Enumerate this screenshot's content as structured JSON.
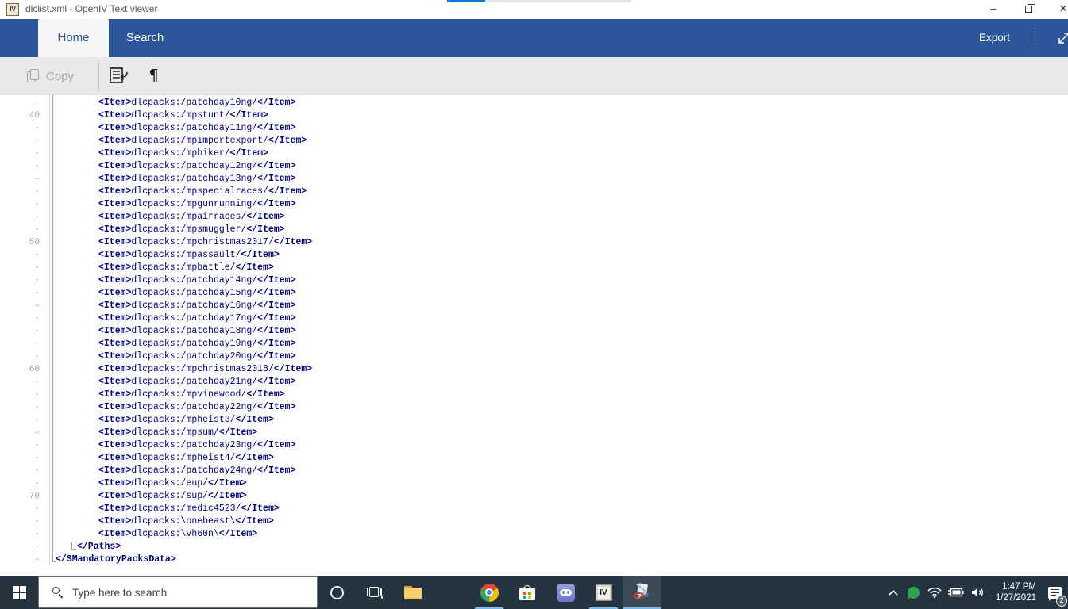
{
  "window": {
    "title": "dlclist.xml - OpenIV Text viewer",
    "icon_label": "IV"
  },
  "ribbon": {
    "tabs": [
      {
        "id": "home",
        "label": "Home",
        "active": true
      },
      {
        "id": "search",
        "label": "Search",
        "active": false
      }
    ],
    "export_label": "Export"
  },
  "toolbar": {
    "copy_label": "Copy",
    "icons": [
      "word-wrap-icon",
      "pilcrow-icon"
    ]
  },
  "editor": {
    "lines": [
      {
        "marker": "-",
        "indent": 2,
        "tag": "Item",
        "text": "dlcpacks:/patchday10ng/"
      },
      {
        "marker": "40",
        "indent": 2,
        "tag": "Item",
        "text": "dlcpacks:/mpstunt/"
      },
      {
        "marker": "-",
        "indent": 2,
        "tag": "Item",
        "text": "dlcpacks:/patchday11ng/"
      },
      {
        "marker": "-",
        "indent": 2,
        "tag": "Item",
        "text": "dlcpacks:/mpimportexport/"
      },
      {
        "marker": "-",
        "indent": 2,
        "tag": "Item",
        "text": "dlcpacks:/mpbiker/"
      },
      {
        "marker": "-",
        "indent": 2,
        "tag": "Item",
        "text": "dlcpacks:/patchday12ng/"
      },
      {
        "marker": "–",
        "indent": 2,
        "tag": "Item",
        "text": "dlcpacks:/patchday13ng/"
      },
      {
        "marker": "-",
        "indent": 2,
        "tag": "Item",
        "text": "dlcpacks:/mpspecialraces/"
      },
      {
        "marker": "-",
        "indent": 2,
        "tag": "Item",
        "text": "dlcpacks:/mpgunrunning/"
      },
      {
        "marker": "-",
        "indent": 2,
        "tag": "Item",
        "text": "dlcpacks:/mpairraces/"
      },
      {
        "marker": "-",
        "indent": 2,
        "tag": "Item",
        "text": "dlcpacks:/mpsmuggler/"
      },
      {
        "marker": "50",
        "indent": 2,
        "tag": "Item",
        "text": "dlcpacks:/mpchristmas2017/"
      },
      {
        "marker": "-",
        "indent": 2,
        "tag": "Item",
        "text": "dlcpacks:/mpassault/"
      },
      {
        "marker": "-",
        "indent": 2,
        "tag": "Item",
        "text": "dlcpacks:/mpbattle/"
      },
      {
        "marker": "-",
        "indent": 2,
        "tag": "Item",
        "text": "dlcpacks:/patchday14ng/"
      },
      {
        "marker": "-",
        "indent": 2,
        "tag": "Item",
        "text": "dlcpacks:/patchday15ng/"
      },
      {
        "marker": "–",
        "indent": 2,
        "tag": "Item",
        "text": "dlcpacks:/patchday16ng/"
      },
      {
        "marker": "-",
        "indent": 2,
        "tag": "Item",
        "text": "dlcpacks:/patchday17ng/"
      },
      {
        "marker": "-",
        "indent": 2,
        "tag": "Item",
        "text": "dlcpacks:/patchday18ng/"
      },
      {
        "marker": "-",
        "indent": 2,
        "tag": "Item",
        "text": "dlcpacks:/patchday19ng/"
      },
      {
        "marker": "-",
        "indent": 2,
        "tag": "Item",
        "text": "dlcpacks:/patchday20ng/"
      },
      {
        "marker": "60",
        "indent": 2,
        "tag": "Item",
        "text": "dlcpacks:/mpchristmas2018/"
      },
      {
        "marker": "-",
        "indent": 2,
        "tag": "Item",
        "text": "dlcpacks:/patchday21ng/"
      },
      {
        "marker": "-",
        "indent": 2,
        "tag": "Item",
        "text": "dlcpacks:/mpvinewood/"
      },
      {
        "marker": "-",
        "indent": 2,
        "tag": "Item",
        "text": "dlcpacks:/patchday22ng/"
      },
      {
        "marker": "-",
        "indent": 2,
        "tag": "Item",
        "text": "dlcpacks:/mpheist3/"
      },
      {
        "marker": "–",
        "indent": 2,
        "tag": "Item",
        "text": "dlcpacks:/mpsum/"
      },
      {
        "marker": "-",
        "indent": 2,
        "tag": "Item",
        "text": "dlcpacks:/patchday23ng/"
      },
      {
        "marker": "-",
        "indent": 2,
        "tag": "Item",
        "text": "dlcpacks:/mpheist4/"
      },
      {
        "marker": "-",
        "indent": 2,
        "tag": "Item",
        "text": "dlcpacks:/patchday24ng/"
      },
      {
        "marker": "-",
        "indent": 2,
        "tag": "Item",
        "text": "dlcpacks:/eup/"
      },
      {
        "marker": "70",
        "indent": 2,
        "tag": "Item",
        "text": "dlcpacks:/sup/"
      },
      {
        "marker": "-",
        "indent": 2,
        "tag": "Item",
        "text": "dlcpacks:/medic4523/"
      },
      {
        "marker": "-",
        "indent": 2,
        "tag": "Item",
        "text": "dlcpacks:\\onebeast\\"
      },
      {
        "marker": "-",
        "indent": 2,
        "tag": "Item",
        "text": "dlcpacks:\\vh60n\\"
      },
      {
        "marker": "-",
        "indent": 1,
        "close": "Paths"
      },
      {
        "marker": "–",
        "indent": 0,
        "close": "SMandatoryPacksData"
      }
    ]
  },
  "taskbar": {
    "search_placeholder": "Type here to search",
    "apps": [
      {
        "name": "task-view",
        "running": false,
        "active": false
      },
      {
        "name": "file-explorer",
        "running": false,
        "active": false
      },
      {
        "name": "edge",
        "running": false,
        "active": false
      },
      {
        "name": "chrome",
        "running": true,
        "active": false
      },
      {
        "name": "store",
        "running": false,
        "active": false
      },
      {
        "name": "discord",
        "running": false,
        "active": false
      },
      {
        "name": "openiv",
        "running": true,
        "active": false
      },
      {
        "name": "snipping-tool",
        "running": true,
        "active": true
      }
    ],
    "openiv_icon_label": "IV",
    "tray": {
      "time": "1:47 PM",
      "date": "1/27/2021",
      "notification_badge": "2"
    }
  },
  "colors": {
    "ribbon_blue": "#2b579a",
    "xml_navy": "#000080",
    "taskbar_dark": "#243340",
    "running_underline": "#76b9ed",
    "artifact_blue": "#0a7ad4"
  }
}
